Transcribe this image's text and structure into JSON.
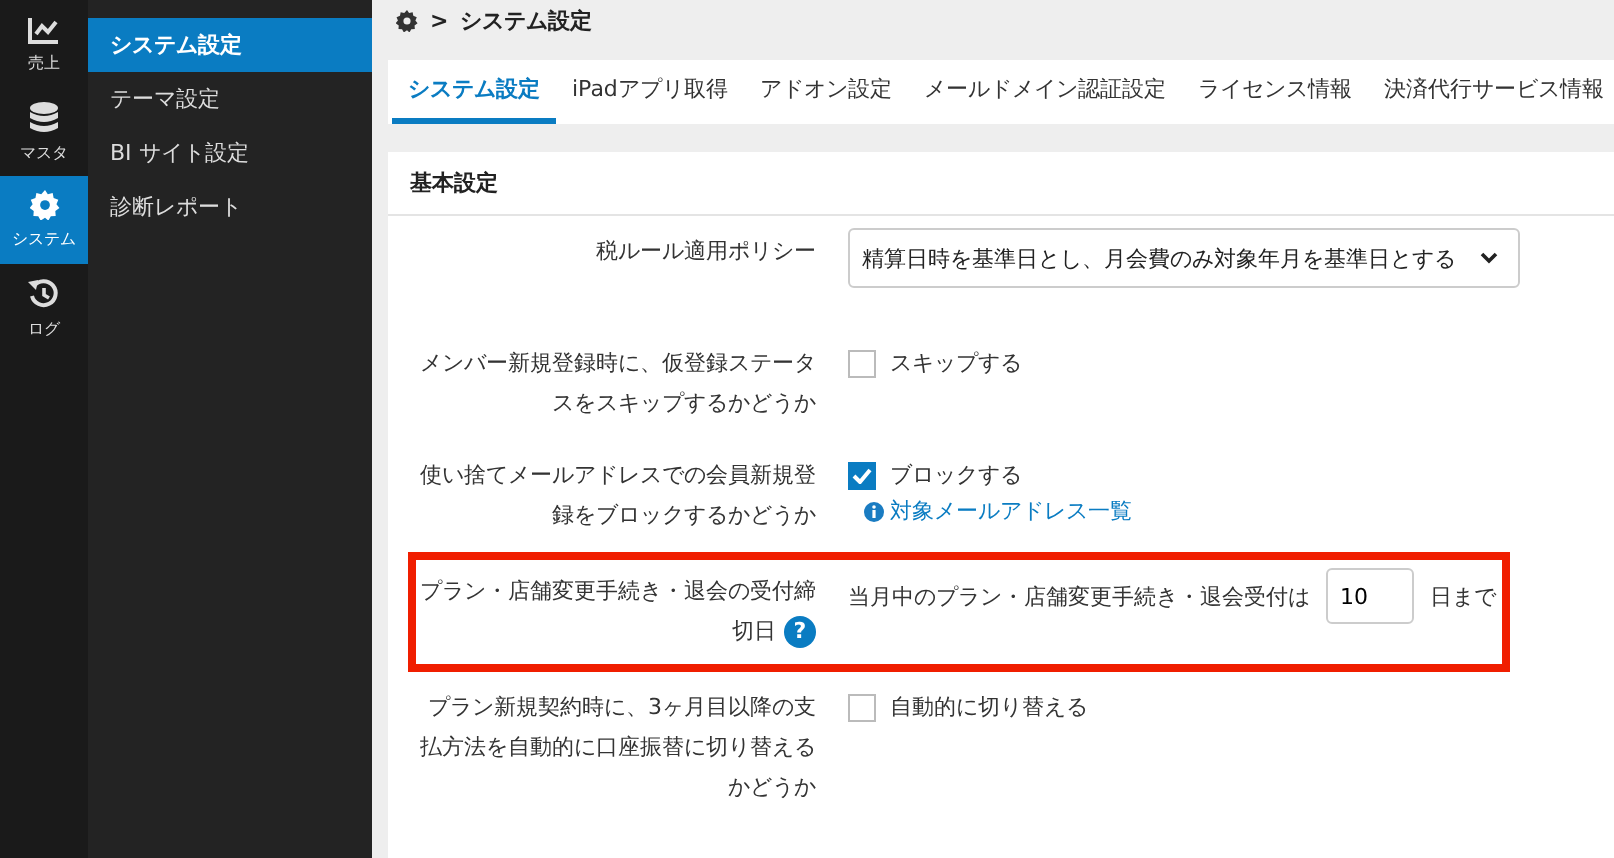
{
  "rail": [
    {
      "label": "売上",
      "selected": false
    },
    {
      "label": "マスタ",
      "selected": false
    },
    {
      "label": "システム",
      "selected": true
    },
    {
      "label": "ログ",
      "selected": false
    }
  ],
  "submenu": [
    {
      "label": "システム設定",
      "selected": true
    },
    {
      "label": "テーマ設定",
      "selected": false
    },
    {
      "label": "BI サイト設定",
      "selected": false
    },
    {
      "label": "診断レポート",
      "selected": false
    }
  ],
  "breadcrumb": {
    "separator": ">",
    "current": "システム設定"
  },
  "tabs": [
    {
      "label": "システム設定",
      "selected": true
    },
    {
      "label": "iPadアプリ取得",
      "selected": false
    },
    {
      "label": "アドオン設定",
      "selected": false
    },
    {
      "label": "メールドメイン認証設定",
      "selected": false
    },
    {
      "label": "ライセンス情報",
      "selected": false
    },
    {
      "label": "決済代行サービス情報",
      "selected": false
    }
  ],
  "section": {
    "title": "基本設定"
  },
  "rows": [
    {
      "kind": "select",
      "label": "税ルール適用ポリシー",
      "value": "精算日時を基準日とし、月会費のみ対象年月を基準日とする",
      "highlighted": false
    },
    {
      "kind": "checkbox",
      "label": "メンバー新規登録時に、仮登録ステータスをスキップするかどうか",
      "option": "スキップする",
      "checked": false,
      "highlighted": false
    },
    {
      "kind": "checkbox",
      "label": "使い捨てメールアドレスでの会員新規登録をブロックするかどうか",
      "option": "ブロックする",
      "checked": true,
      "link": "対象メールアドレス一覧",
      "highlighted": false
    },
    {
      "kind": "number",
      "label": "プラン・店舗変更手続き・退会の受付締切日",
      "help": "?",
      "prefix": "当月中のプラン・店舗変更手続き・退会受付は",
      "value": "10",
      "suffix": "日まで",
      "highlighted": true
    },
    {
      "kind": "checkbox",
      "label": "プラン新規契約時に、3ヶ月目以降の支払方法を自動的に口座振替に切り替えるかどうか",
      "option": "自動的に切り替える",
      "checked": false,
      "highlighted": false
    }
  ]
}
